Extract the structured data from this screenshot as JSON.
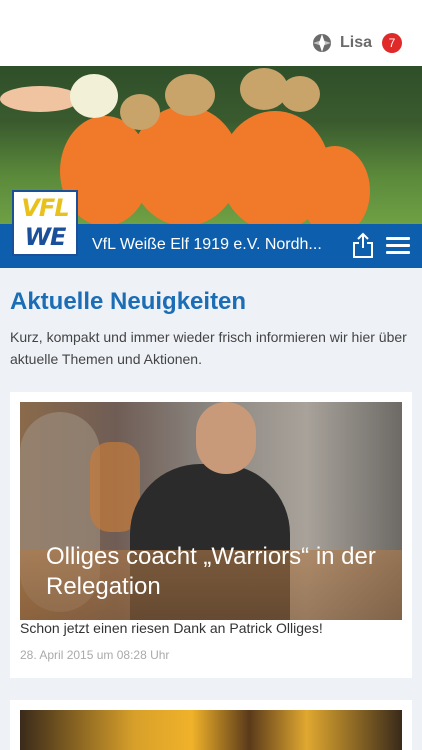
{
  "topbar": {
    "user_name": "Lisa",
    "notification_count": "7",
    "logo_icon": "app-logo-icon"
  },
  "club": {
    "name": "VfL Weiße Elf 1919 e.V. Nordh...",
    "logo_text_top": "VFL",
    "logo_text_bottom": "WE",
    "share_icon": "share-icon",
    "menu_icon": "hamburger-menu-icon"
  },
  "news": {
    "title": "Aktuelle Neuigkeiten",
    "intro": "Kurz, kompakt und immer wieder frisch informieren wir hier über aktuelle Themen und Aktionen.",
    "items": [
      {
        "headline": "Olliges coacht „Warriors“ in der Relegation",
        "teaser": "Schon jetzt einen riesen Dank an Patrick Olliges!",
        "date": "28. April 2015 um 08:28 Uhr"
      }
    ]
  },
  "colors": {
    "brand_blue": "#0d5fae",
    "title_blue": "#1b6db5",
    "badge_red": "#e02a2a",
    "logo_yellow": "#e8c21a"
  }
}
